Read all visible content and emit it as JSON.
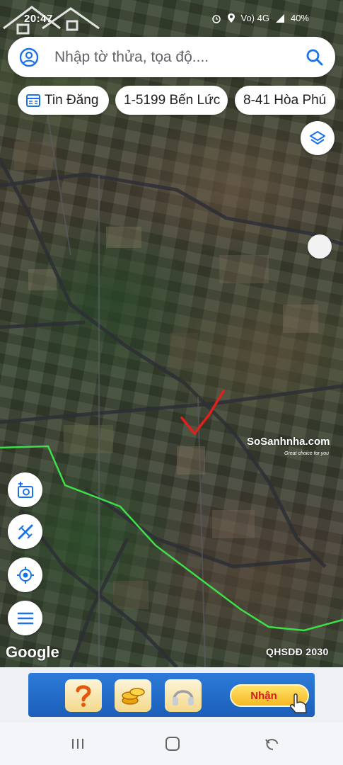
{
  "status_bar": {
    "time": "20:47",
    "battery": "40%",
    "network": "Vo) 4G",
    "icons": [
      "alarm-icon",
      "location-icon",
      "signal-icon",
      "battery-icon"
    ]
  },
  "search": {
    "placeholder": "Nhập tờ thửa, tọa độ...."
  },
  "chips": [
    {
      "label": "Tin Đăng",
      "icon": "listing-icon"
    },
    {
      "label": "1-5199 Bến Lức"
    },
    {
      "label": "8-41 Hòa Phú"
    }
  ],
  "map": {
    "attribution": "Google",
    "plan_label": "QHSDĐ 2030",
    "watermark_brand": "SoSanhnha.com",
    "watermark_tagline": "Great choice for you"
  },
  "side_buttons": [
    "camera-plus-icon",
    "measure-icon",
    "my-location-icon",
    "menu-icon"
  ],
  "ad": {
    "button_label": "Nhận",
    "tiles": [
      "question-icon",
      "coins-icon",
      "headphones-icon"
    ]
  },
  "colors": {
    "accent": "#1a73e8",
    "plan_boundary": "#3ee04a",
    "checkmark": "#e0201b",
    "ad_blue": "#1f66c1"
  }
}
